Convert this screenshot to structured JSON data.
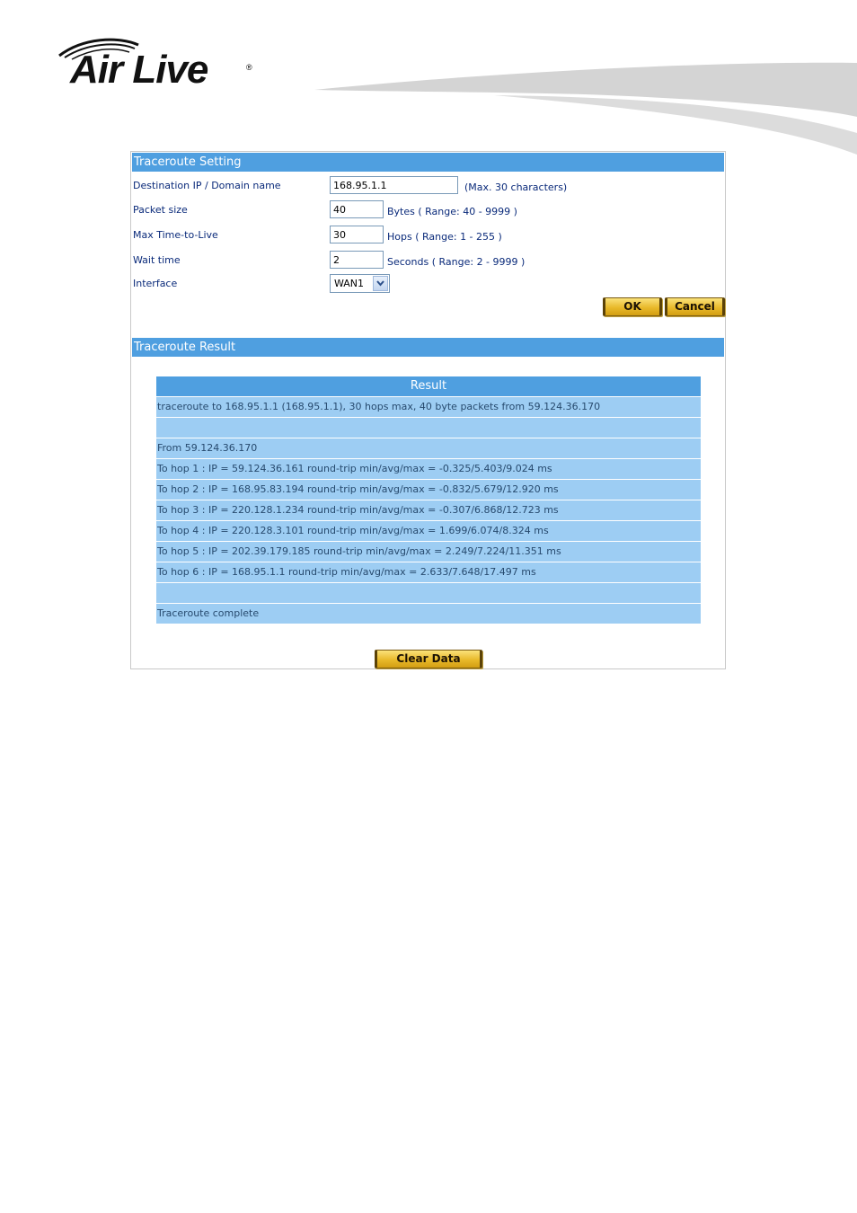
{
  "logo": {
    "text": "Air Live",
    "reg": "®"
  },
  "setting": {
    "title": "Traceroute Setting",
    "fields": [
      {
        "label": "Destination IP / Domain name",
        "value": "168.95.1.1",
        "hint": "(Max. 30 characters)"
      },
      {
        "label": "Packet size",
        "value": "40",
        "hint": "Bytes  ( Range: 40 - 9999 )"
      },
      {
        "label": "Max Time-to-Live",
        "value": "30",
        "hint": "Hops  ( Range: 1 - 255 )"
      },
      {
        "label": "Wait time",
        "value": "2",
        "hint": "Seconds  ( Range: 2 - 9999 )"
      },
      {
        "label": "Interface",
        "value": "WAN1"
      }
    ],
    "ok_label": "OK",
    "cancel_label": "Cancel"
  },
  "result": {
    "title": "Traceroute Result",
    "header": "Result",
    "rows": [
      "traceroute to 168.95.1.1 (168.95.1.1), 30 hops max, 40 byte packets from 59.124.36.170",
      "",
      "From 59.124.36.170",
      "To hop 1 : IP = 59.124.36.161  round-trip min/avg/max = -0.325/5.403/9.024 ms",
      "To hop 2 : IP = 168.95.83.194  round-trip min/avg/max = -0.832/5.679/12.920 ms",
      "To hop 3 : IP = 220.128.1.234  round-trip min/avg/max = -0.307/6.868/12.723 ms",
      "To hop 4 : IP = 220.128.3.101  round-trip min/avg/max = 1.699/6.074/8.324 ms",
      "To hop 5 : IP = 202.39.179.185  round-trip min/avg/max = 2.249/7.224/11.351 ms",
      "To hop 6 : IP = 168.95.1.1  round-trip min/avg/max = 2.633/7.648/17.497 ms",
      "",
      "Traceroute complete"
    ],
    "clear_label": "Clear Data"
  },
  "colors": {
    "bar": "#4f9fe0",
    "row": "#9dcdf3",
    "button": "#e8b92a"
  }
}
